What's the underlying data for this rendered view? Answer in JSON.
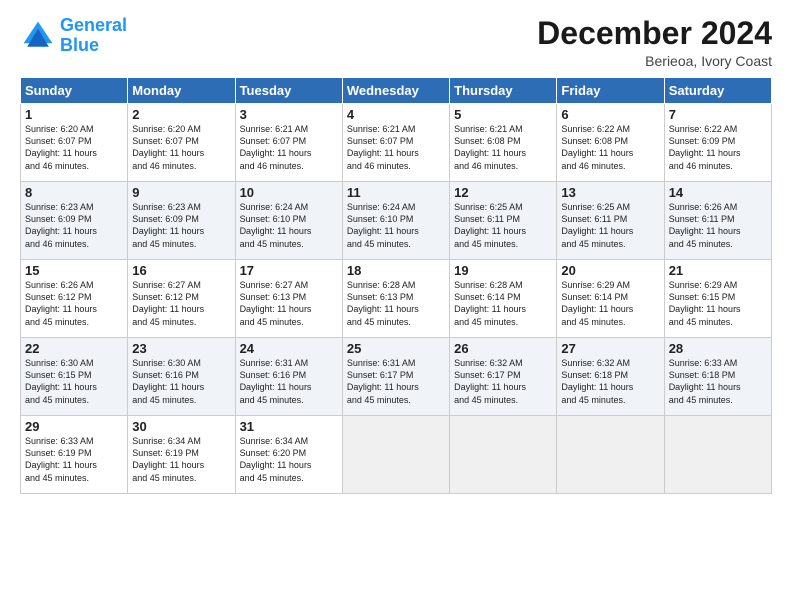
{
  "header": {
    "logo_line1": "General",
    "logo_line2": "Blue",
    "month": "December 2024",
    "location": "Berieoa, Ivory Coast"
  },
  "days_of_week": [
    "Sunday",
    "Monday",
    "Tuesday",
    "Wednesday",
    "Thursday",
    "Friday",
    "Saturday"
  ],
  "weeks": [
    [
      {
        "day": 1,
        "info": "Sunrise: 6:20 AM\nSunset: 6:07 PM\nDaylight: 11 hours\nand 46 minutes."
      },
      {
        "day": 2,
        "info": "Sunrise: 6:20 AM\nSunset: 6:07 PM\nDaylight: 11 hours\nand 46 minutes."
      },
      {
        "day": 3,
        "info": "Sunrise: 6:21 AM\nSunset: 6:07 PM\nDaylight: 11 hours\nand 46 minutes."
      },
      {
        "day": 4,
        "info": "Sunrise: 6:21 AM\nSunset: 6:07 PM\nDaylight: 11 hours\nand 46 minutes."
      },
      {
        "day": 5,
        "info": "Sunrise: 6:21 AM\nSunset: 6:08 PM\nDaylight: 11 hours\nand 46 minutes."
      },
      {
        "day": 6,
        "info": "Sunrise: 6:22 AM\nSunset: 6:08 PM\nDaylight: 11 hours\nand 46 minutes."
      },
      {
        "day": 7,
        "info": "Sunrise: 6:22 AM\nSunset: 6:09 PM\nDaylight: 11 hours\nand 46 minutes."
      }
    ],
    [
      {
        "day": 8,
        "info": "Sunrise: 6:23 AM\nSunset: 6:09 PM\nDaylight: 11 hours\nand 46 minutes."
      },
      {
        "day": 9,
        "info": "Sunrise: 6:23 AM\nSunset: 6:09 PM\nDaylight: 11 hours\nand 45 minutes."
      },
      {
        "day": 10,
        "info": "Sunrise: 6:24 AM\nSunset: 6:10 PM\nDaylight: 11 hours\nand 45 minutes."
      },
      {
        "day": 11,
        "info": "Sunrise: 6:24 AM\nSunset: 6:10 PM\nDaylight: 11 hours\nand 45 minutes."
      },
      {
        "day": 12,
        "info": "Sunrise: 6:25 AM\nSunset: 6:11 PM\nDaylight: 11 hours\nand 45 minutes."
      },
      {
        "day": 13,
        "info": "Sunrise: 6:25 AM\nSunset: 6:11 PM\nDaylight: 11 hours\nand 45 minutes."
      },
      {
        "day": 14,
        "info": "Sunrise: 6:26 AM\nSunset: 6:11 PM\nDaylight: 11 hours\nand 45 minutes."
      }
    ],
    [
      {
        "day": 15,
        "info": "Sunrise: 6:26 AM\nSunset: 6:12 PM\nDaylight: 11 hours\nand 45 minutes."
      },
      {
        "day": 16,
        "info": "Sunrise: 6:27 AM\nSunset: 6:12 PM\nDaylight: 11 hours\nand 45 minutes."
      },
      {
        "day": 17,
        "info": "Sunrise: 6:27 AM\nSunset: 6:13 PM\nDaylight: 11 hours\nand 45 minutes."
      },
      {
        "day": 18,
        "info": "Sunrise: 6:28 AM\nSunset: 6:13 PM\nDaylight: 11 hours\nand 45 minutes."
      },
      {
        "day": 19,
        "info": "Sunrise: 6:28 AM\nSunset: 6:14 PM\nDaylight: 11 hours\nand 45 minutes."
      },
      {
        "day": 20,
        "info": "Sunrise: 6:29 AM\nSunset: 6:14 PM\nDaylight: 11 hours\nand 45 minutes."
      },
      {
        "day": 21,
        "info": "Sunrise: 6:29 AM\nSunset: 6:15 PM\nDaylight: 11 hours\nand 45 minutes."
      }
    ],
    [
      {
        "day": 22,
        "info": "Sunrise: 6:30 AM\nSunset: 6:15 PM\nDaylight: 11 hours\nand 45 minutes."
      },
      {
        "day": 23,
        "info": "Sunrise: 6:30 AM\nSunset: 6:16 PM\nDaylight: 11 hours\nand 45 minutes."
      },
      {
        "day": 24,
        "info": "Sunrise: 6:31 AM\nSunset: 6:16 PM\nDaylight: 11 hours\nand 45 minutes."
      },
      {
        "day": 25,
        "info": "Sunrise: 6:31 AM\nSunset: 6:17 PM\nDaylight: 11 hours\nand 45 minutes."
      },
      {
        "day": 26,
        "info": "Sunrise: 6:32 AM\nSunset: 6:17 PM\nDaylight: 11 hours\nand 45 minutes."
      },
      {
        "day": 27,
        "info": "Sunrise: 6:32 AM\nSunset: 6:18 PM\nDaylight: 11 hours\nand 45 minutes."
      },
      {
        "day": 28,
        "info": "Sunrise: 6:33 AM\nSunset: 6:18 PM\nDaylight: 11 hours\nand 45 minutes."
      }
    ],
    [
      {
        "day": 29,
        "info": "Sunrise: 6:33 AM\nSunset: 6:19 PM\nDaylight: 11 hours\nand 45 minutes."
      },
      {
        "day": 30,
        "info": "Sunrise: 6:34 AM\nSunset: 6:19 PM\nDaylight: 11 hours\nand 45 minutes."
      },
      {
        "day": 31,
        "info": "Sunrise: 6:34 AM\nSunset: 6:20 PM\nDaylight: 11 hours\nand 45 minutes."
      },
      null,
      null,
      null,
      null
    ]
  ]
}
